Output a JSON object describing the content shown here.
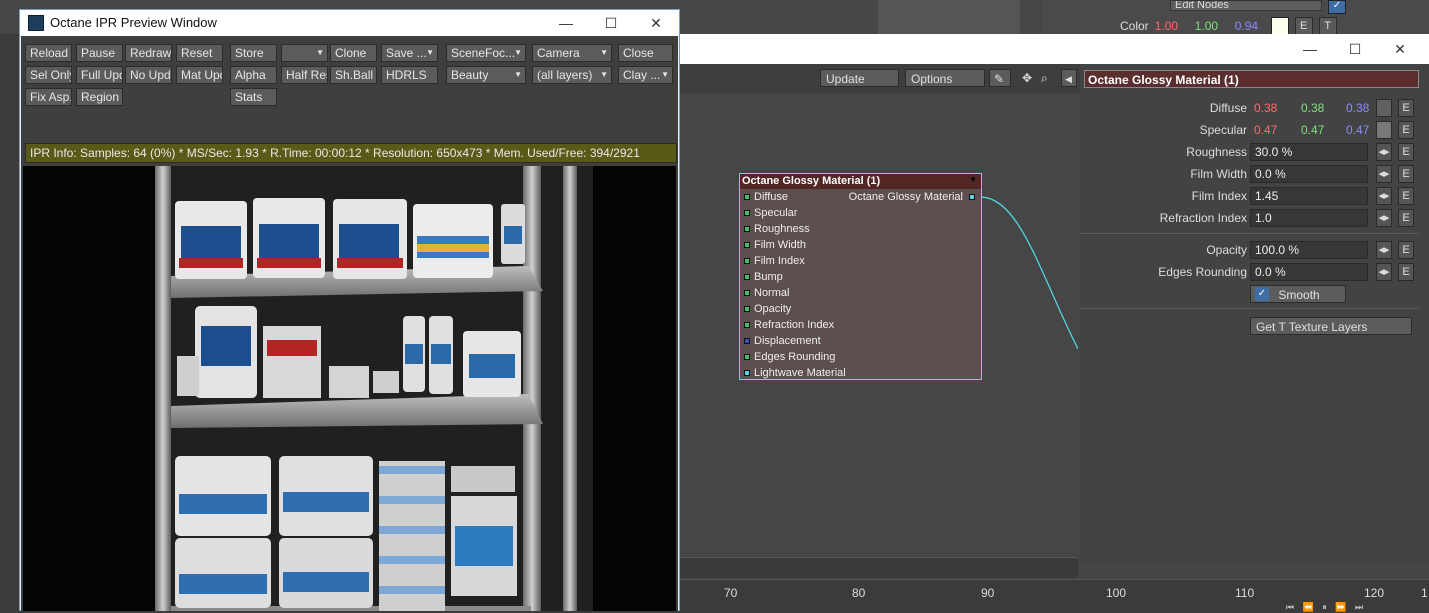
{
  "background_app": {
    "edit_nodes_label": "Edit Nodes",
    "color_label": "Color",
    "color_values": [
      "1.00",
      "1.00",
      "0.94"
    ],
    "color_value_colors": [
      "#ff6b6b",
      "#7de07d",
      "#8a8aff"
    ],
    "e_label": "E",
    "t_label": "T"
  },
  "node_window": {
    "toolbar": {
      "update_label": "Update",
      "options_label": "Options"
    },
    "material_header": "Octane Glossy Material (1)",
    "props": {
      "diffuse_label": "Diffuse",
      "diffuse_values": [
        "0.38",
        "0.38",
        "0.38"
      ],
      "specular_label": "Specular",
      "specular_values": [
        "0.47",
        "0.47",
        "0.47"
      ],
      "roughness_label": "Roughness",
      "roughness_value": "30.0 %",
      "film_width_label": "Film Width",
      "film_width_value": "0.0 %",
      "film_index_label": "Film Index",
      "film_index_value": "1.45",
      "refraction_index_label": "Refraction Index",
      "refraction_index_value": "1.0",
      "opacity_label": "Opacity",
      "opacity_value": "100.0 %",
      "edges_rounding_label": "Edges Rounding",
      "edges_rounding_value": "0.0 %",
      "smooth_label": "Smooth",
      "get_texture_layers_label": "Get T Texture Layers",
      "e_label": "E"
    },
    "node": {
      "title": "Octane Glossy Material (1)",
      "output_label": "Octane Glossy Material",
      "inputs": [
        {
          "label": "Diffuse",
          "color": "#3fbf6a"
        },
        {
          "label": "Specular",
          "color": "#3fbf6a"
        },
        {
          "label": "Roughness",
          "color": "#3fbf6a"
        },
        {
          "label": "Film Width",
          "color": "#3fbf6a"
        },
        {
          "label": "Film Index",
          "color": "#3fbf6a"
        },
        {
          "label": "Bump",
          "color": "#3fbf6a"
        },
        {
          "label": "Normal",
          "color": "#3fbf6a"
        },
        {
          "label": "Opacity",
          "color": "#3fbf6a"
        },
        {
          "label": "Refraction Index",
          "color": "#3fbf6a"
        },
        {
          "label": "Displacement",
          "color": "#3a4fb8"
        },
        {
          "label": "Edges Rounding",
          "color": "#3fbf6a"
        },
        {
          "label": "Lightwave Material",
          "color": "#4fd6e0"
        }
      ]
    },
    "ruler_ticks": [
      "70",
      "80",
      "90",
      "100",
      "110",
      "120",
      "1"
    ]
  },
  "ipr": {
    "title": "Octane IPR Preview Window",
    "row1": [
      "Reload",
      "Pause",
      "Redraw",
      "Reset",
      "Store",
      "",
      "Clone",
      "Save ...",
      "SceneFoc...",
      "Camera",
      "Close"
    ],
    "row2": [
      "Sel Only",
      "Full Upd.",
      "No Upd.",
      "Mat Upd",
      "Alpha",
      "Half Res",
      "Sh.Ball",
      "HDRLS",
      "Beauty",
      "(all layers)",
      "Clay ..."
    ],
    "row3": [
      "Fix Asp.",
      "Region",
      "Stats"
    ],
    "info": "IPR Info:  Samples: 64 (0%)  *  MS/Sec: 1.93  *  R.Time: 00:00:12  *  Resolution: 650x473  *  Mem. Used/Free: 394/2921"
  }
}
